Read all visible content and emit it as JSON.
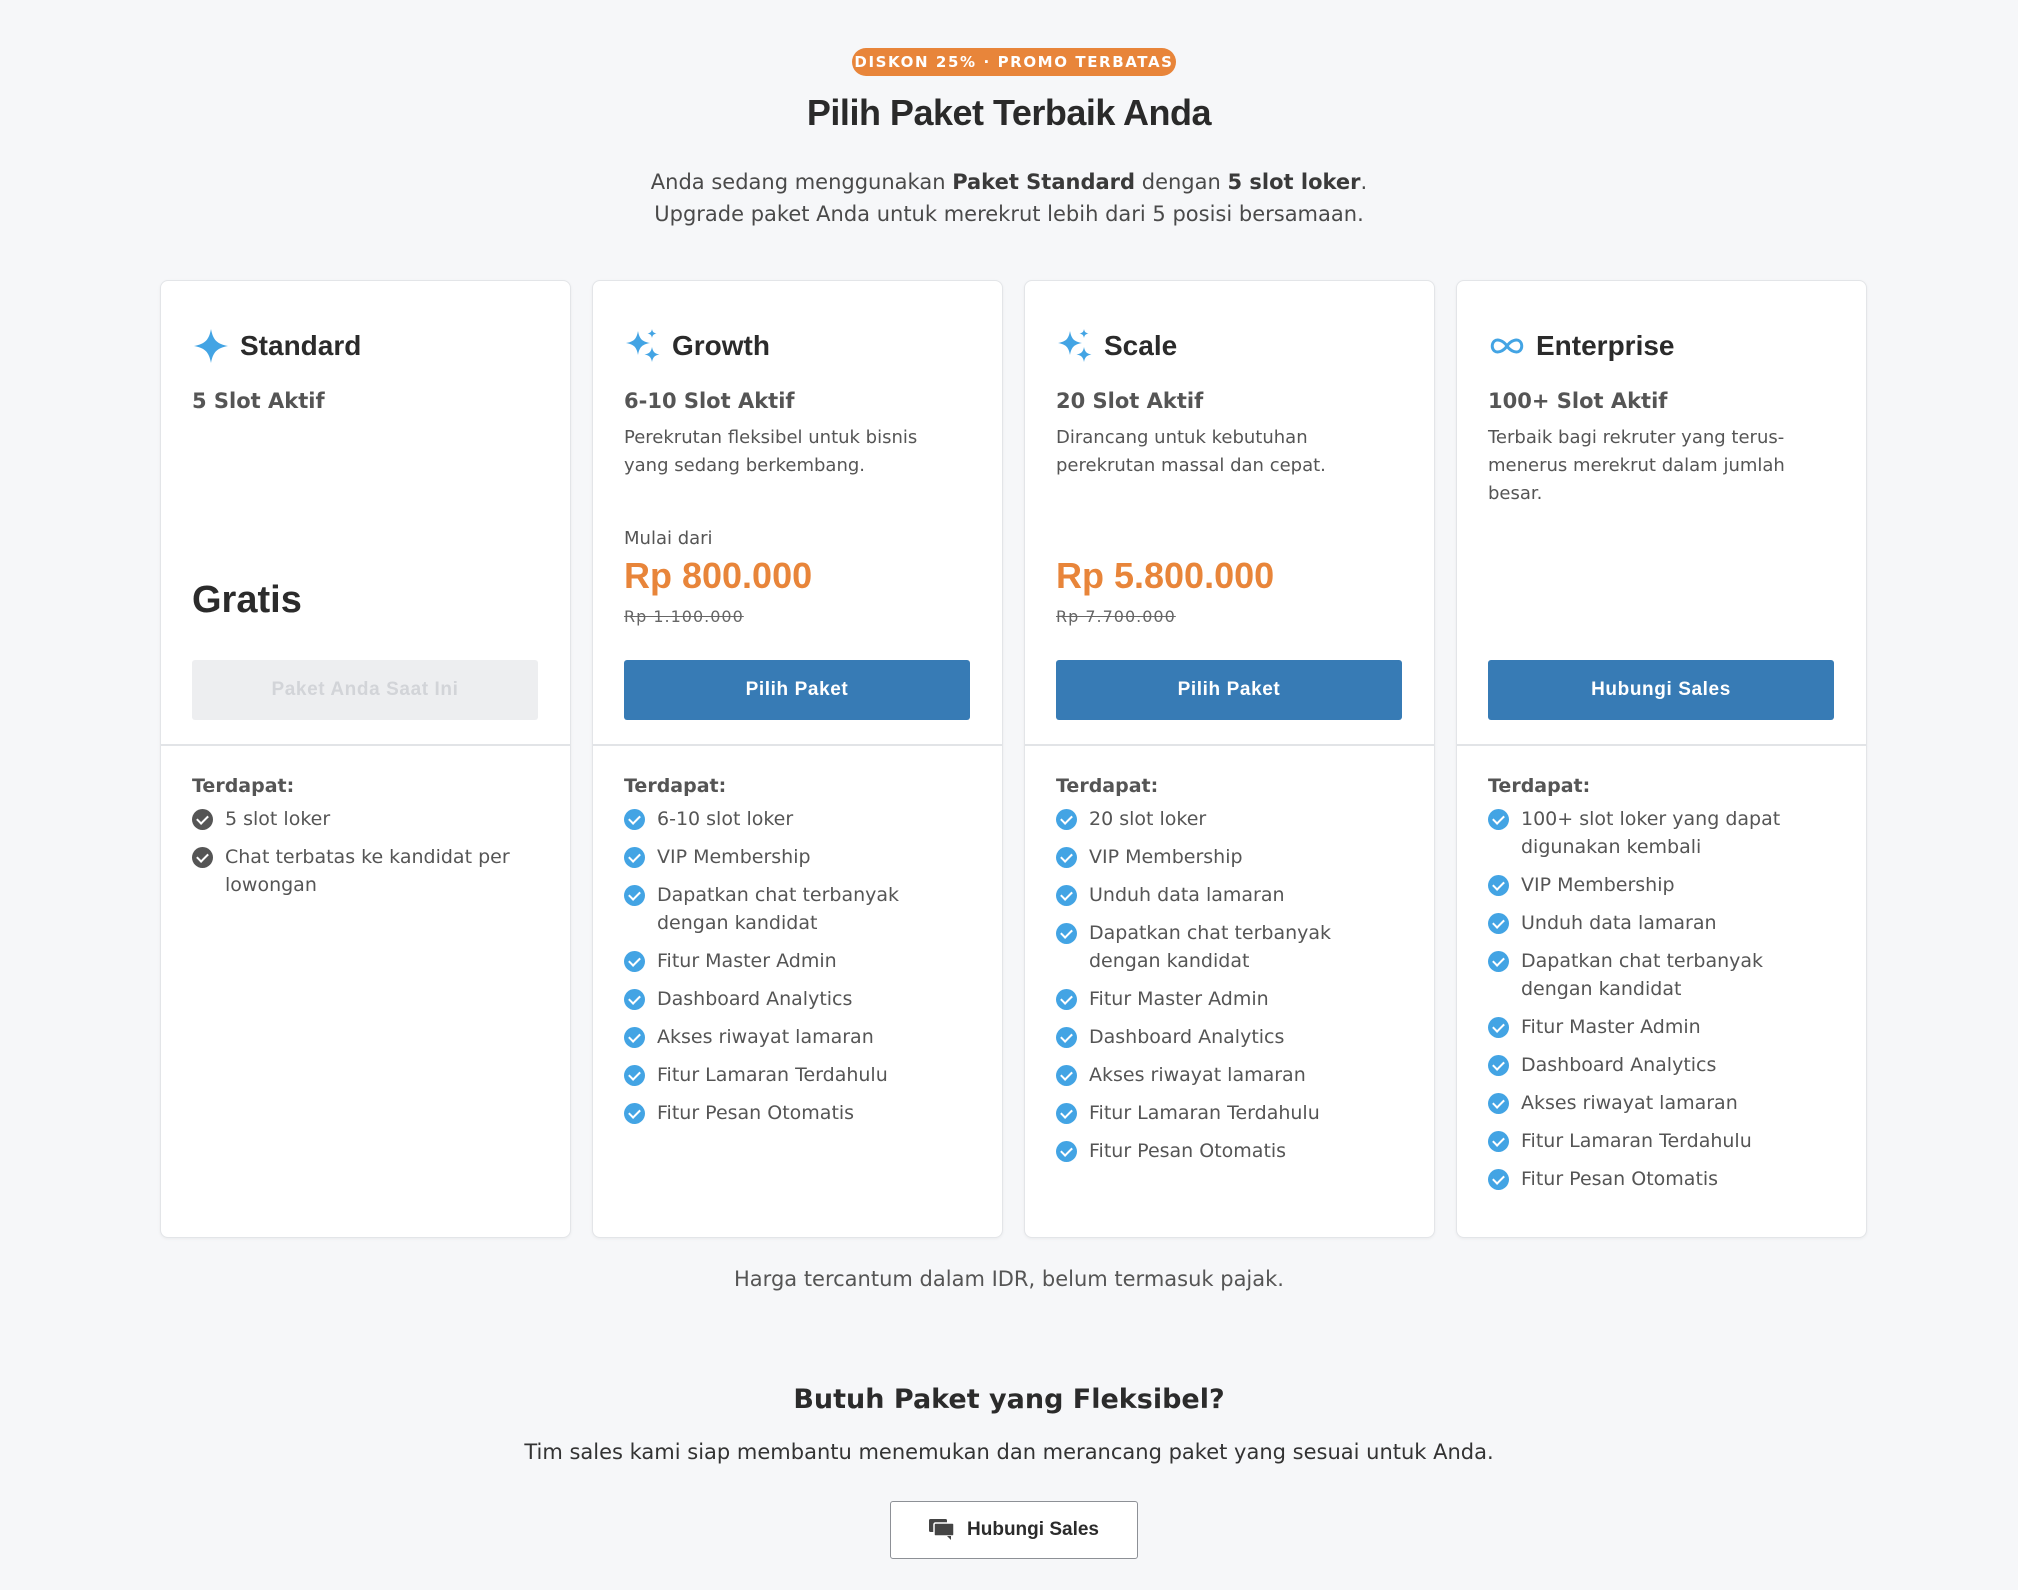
{
  "header": {
    "promo_badge": "DISKON 25% · PROMO TERBATAS",
    "title": "Pilih Paket Terbaik Anda",
    "subtitle_line1_pre": "Anda sedang menggunakan ",
    "subtitle_line1_plan": "Paket Standard",
    "subtitle_line1_mid": " dengan ",
    "subtitle_line1_slots": "5 slot loker",
    "subtitle_line1_post": ".",
    "subtitle_line2": "Upgrade paket Anda untuk merekrut lebih dari 5 posisi bersamaan."
  },
  "colors": {
    "accent": "#e8853a",
    "primary": "#377bb5",
    "check": "#43a4e4",
    "background": "#f6f7f9"
  },
  "plans": [
    {
      "icon": "sparkle-icon",
      "name": "Standard",
      "slots": "5 Slot Aktif",
      "description": "",
      "price": "Gratis",
      "cta": "Paket Anda Saat Ini",
      "features_label": "Terdapat:",
      "features": [
        "5 slot loker",
        "Chat terbatas ke kandidat per lowongan"
      ]
    },
    {
      "icon": "sparkles-icon",
      "name": "Growth",
      "slots": "6-10 Slot Aktif",
      "description": "Perekrutan fleksibel untuk bisnis yang sedang berkembang.",
      "price_prefix": "Mulai dari",
      "price": "Rp 800.000",
      "price_old": "Rp 1.100.000",
      "cta": "Pilih Paket",
      "features_label": "Terdapat:",
      "features": [
        "6-10 slot loker",
        "VIP Membership",
        "Dapatkan chat terbanyak dengan kandidat",
        "Fitur Master Admin",
        "Dashboard Analytics",
        "Akses riwayat lamaran",
        "Fitur Lamaran Terdahulu",
        "Fitur Pesan Otomatis"
      ]
    },
    {
      "icon": "sparkles-icon",
      "name": "Scale",
      "slots": "20 Slot Aktif",
      "description": "Dirancang untuk kebutuhan perekrutan massal dan cepat.",
      "price": "Rp 5.800.000",
      "price_old": "Rp 7.700.000",
      "cta": "Pilih Paket",
      "features_label": "Terdapat:",
      "features": [
        "20 slot loker",
        "VIP Membership",
        "Unduh data lamaran",
        "Dapatkan chat terbanyak dengan kandidat",
        "Fitur Master Admin",
        "Dashboard Analytics",
        "Akses riwayat lamaran",
        "Fitur Lamaran Terdahulu",
        "Fitur Pesan Otomatis"
      ]
    },
    {
      "icon": "infinity-icon",
      "name": "Enterprise",
      "slots": "100+ Slot Aktif",
      "description": "Terbaik bagi rekruter yang terus-menerus merekrut dalam jumlah besar.",
      "cta": "Hubungi Sales",
      "features_label": "Terdapat:",
      "features": [
        "100+ slot loker yang dapat digunakan kembali",
        "VIP Membership",
        "Unduh data lamaran",
        "Dapatkan chat terbanyak dengan kandidat",
        "Fitur Master Admin",
        "Dashboard Analytics",
        "Akses riwayat lamaran",
        "Fitur Lamaran Terdahulu",
        "Fitur Pesan Otomatis"
      ]
    }
  ],
  "footnote": "Harga tercantum dalam IDR, belum termasuk pajak.",
  "flexible": {
    "title": "Butuh Paket yang Fleksibel?",
    "description": "Tim sales kami siap membantu menemukan dan merancang paket yang sesuai untuk Anda.",
    "button_icon": "chat-icon",
    "button_label": "Hubungi Sales"
  }
}
